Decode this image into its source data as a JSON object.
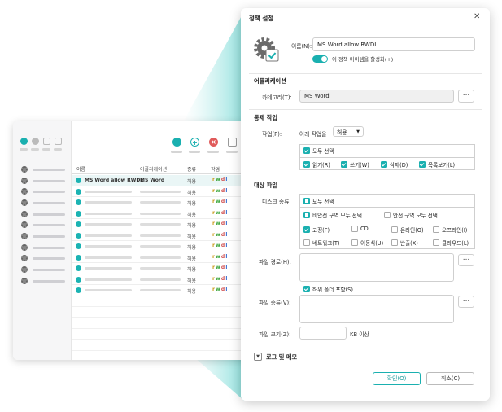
{
  "app_table": {
    "headers": [
      "이름",
      "어플리케이션",
      "종류",
      "작업"
    ],
    "first_row": {
      "name": "MS Word allow RWDL",
      "app": "MS Word",
      "kind": "허용",
      "ops": "rwdl"
    },
    "other_kind": "허용",
    "other_ops": "rwdl"
  },
  "dialog": {
    "title": "정책 설정",
    "name_label": "이름(N):",
    "name_value": "MS Word allow RWDL",
    "activate_label": "이 정책 아이템을 활성화(+)",
    "app_section": "어플리케이션",
    "category_label": "카테고리(T):",
    "category_value": "MS Word",
    "more": "...",
    "control_section": "통제 작업",
    "op_label": "작업(P):",
    "op_prefix": "아래 작업을",
    "op_select": "허용",
    "all_select": "모두 선택",
    "ops": [
      "읽기(R)",
      "쓰기(W)",
      "삭제(D)",
      "목록보기(L)"
    ],
    "target_section": "대상 파일",
    "disk_label": "디스크 종류:",
    "disk_all": "모두 선택",
    "unsafe_all": "비안전 구역 모두 선택",
    "safe_all": "안전 구역 모두 선택",
    "disks": [
      "고정(F)",
      "CD",
      "온라인(O)",
      "오프라인(I)",
      "네트워크(T)",
      "이동식(U)",
      "반출(X)",
      "클라우드(L)"
    ],
    "path_label": "파일 경로(H):",
    "subfolder": "하위 폴더 포함(S)",
    "type_label": "파일 종류(V):",
    "size_label": "파일 크기(Z):",
    "size_unit": "KB 이상",
    "log_label": "로그 및 메모",
    "ok": "확인(O)",
    "cancel": "취소(C)"
  }
}
